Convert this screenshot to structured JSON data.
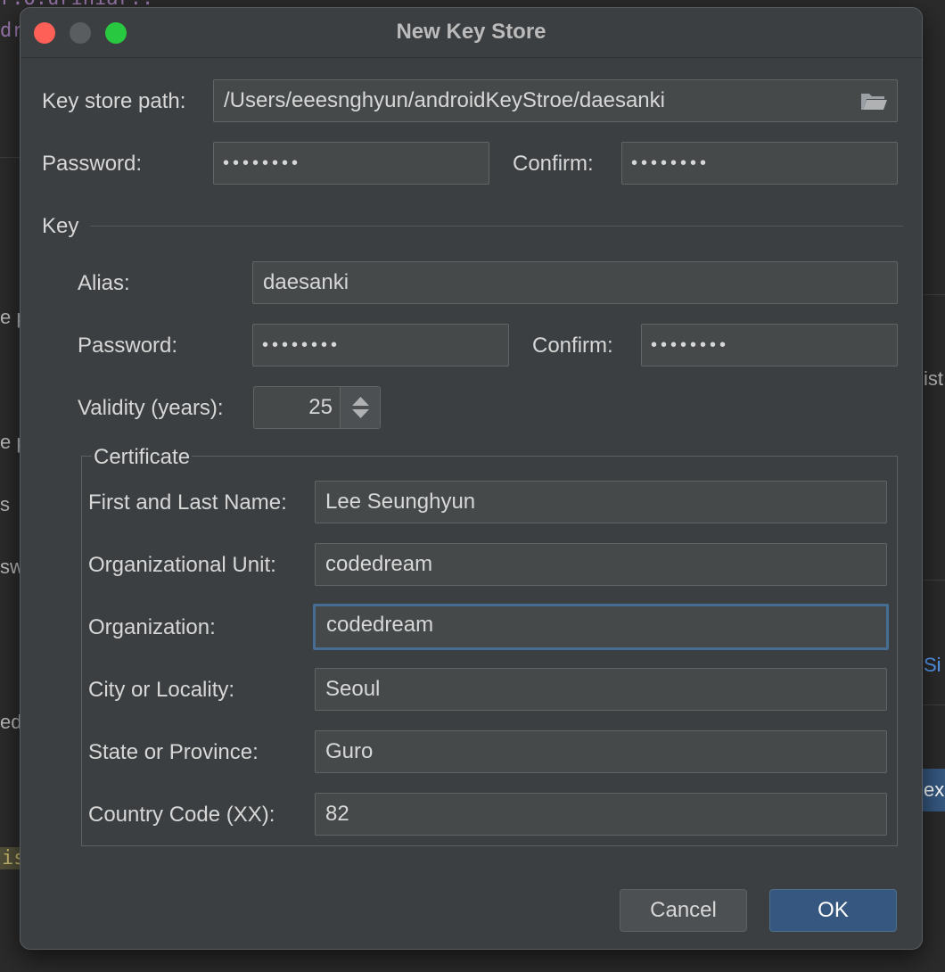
{
  "background": {
    "code_line_1": "r.o.uriniar..",
    "code_line_2": "dr",
    "frag_1": "e p",
    "frag_2": "e p",
    "frag_3": "s",
    "frag_4": "sw",
    "frag_5": "ed",
    "frag_6": "is",
    "right_frag_1": "ist",
    "right_frag_2": "Si",
    "right_button": "ex"
  },
  "dialog": {
    "title": "New Key Store",
    "keystore_path_label": "Key store path:",
    "keystore_path_value": "/Users/eeesnghyun/androidKeyStroe/daesanki",
    "folder_icon": "folder-icon",
    "password_label": "Password:",
    "password_value": "••••••••",
    "confirm_label": "Confirm:",
    "confirm_value": "••••••••",
    "key_group_label": "Key",
    "key": {
      "alias_label": "Alias:",
      "alias_value": "daesanki",
      "password_label": "Password:",
      "password_value": "••••••••",
      "confirm_label": "Confirm:",
      "confirm_value": "••••••••",
      "validity_label": "Validity (years):",
      "validity_value": "25"
    },
    "certificate": {
      "title": "Certificate",
      "first_last_label": "First and Last Name:",
      "first_last_value": "Lee Seunghyun",
      "org_unit_label": "Organizational Unit:",
      "org_unit_value": "codedream",
      "org_label": "Organization:",
      "org_value": "codedream",
      "city_label": "City or Locality:",
      "city_value": "Seoul",
      "state_label": "State or Province:",
      "state_value": "Guro",
      "country_label": "Country Code (XX):",
      "country_value": "82"
    },
    "cancel_label": "Cancel",
    "ok_label": "OK"
  },
  "colors": {
    "accent": "#365880",
    "focus_border": "#466d94",
    "dialog_bg": "#3c3f41",
    "field_bg": "#45494a"
  }
}
